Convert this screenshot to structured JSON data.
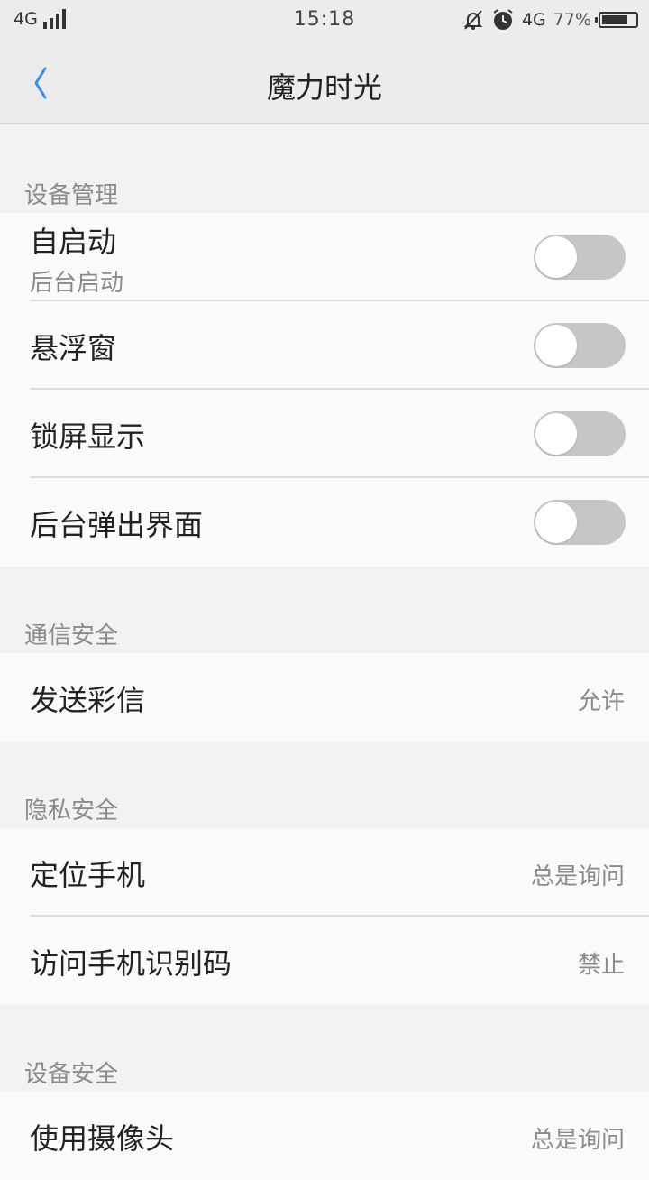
{
  "status_bar": {
    "network": "4G",
    "time": "15:18",
    "network_right": "4G",
    "battery": "77%",
    "battery_level": 0.77
  },
  "header": {
    "title": "魔力时光",
    "back_icon": "chevron-left-icon",
    "accent_color": "#3a8ee6"
  },
  "sections": [
    {
      "label": "设备管理",
      "rows": [
        {
          "label": "自启动",
          "sub": "后台启动",
          "control": "toggle",
          "on": false
        },
        {
          "label": "悬浮窗",
          "control": "toggle",
          "on": false
        },
        {
          "label": "锁屏显示",
          "control": "toggle",
          "on": false
        },
        {
          "label": "后台弹出界面",
          "control": "toggle",
          "on": false
        }
      ]
    },
    {
      "label": "通信安全",
      "rows": [
        {
          "label": "发送彩信",
          "value": "允许"
        }
      ]
    },
    {
      "label": "隐私安全",
      "rows": [
        {
          "label": "定位手机",
          "value": "总是询问"
        },
        {
          "label": "访问手机识别码",
          "value": "禁止"
        }
      ]
    },
    {
      "label": "设备安全",
      "rows": [
        {
          "label": "使用摄像头",
          "value": "总是询问"
        }
      ]
    }
  ]
}
